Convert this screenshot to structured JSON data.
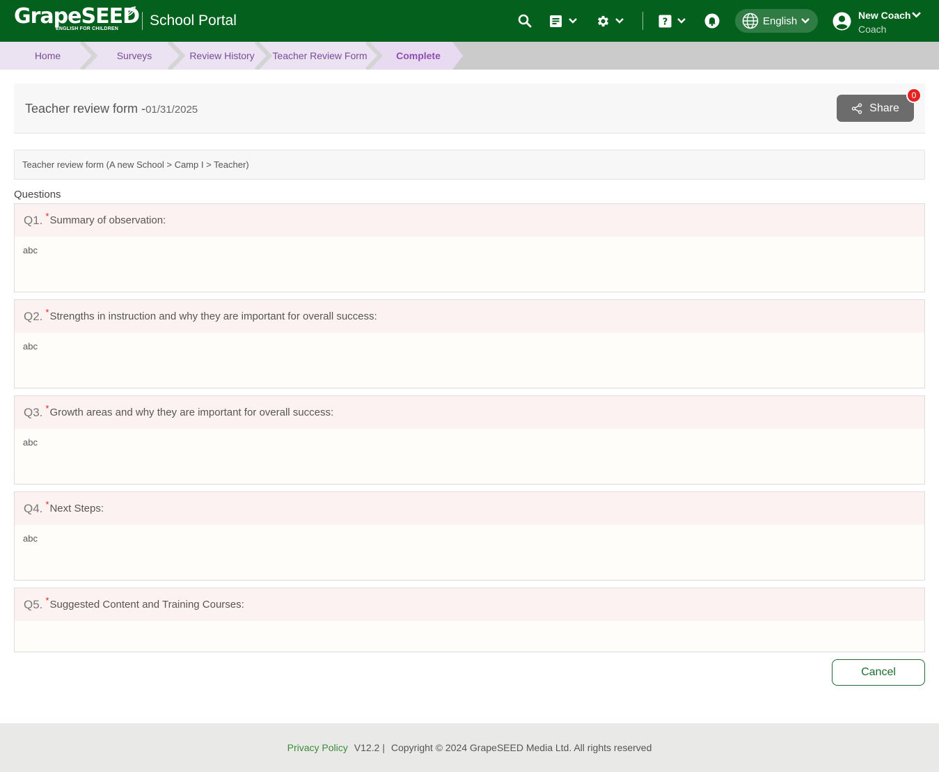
{
  "header": {
    "logo_text": "GrapeSEED",
    "logo_tagline": "ENGLISH FOR CHILDREN",
    "portal_title": "School Portal",
    "language": "English",
    "user_name": "New Coach",
    "user_role": "Coach",
    "colors": {
      "bar": "#03601d"
    },
    "icons": [
      "search-icon",
      "document-icon",
      "gear-icon",
      "help-icon",
      "bell-icon",
      "globe-icon",
      "user-avatar-icon"
    ]
  },
  "breadcrumbs": [
    {
      "label": "Home"
    },
    {
      "label": "Surveys"
    },
    {
      "label": "Review History"
    },
    {
      "label": "Teacher Review Form"
    },
    {
      "label": "Complete"
    }
  ],
  "page": {
    "title": "Teacher review form -",
    "date": "01/31/2025",
    "share_label": "Share",
    "share_count": "0",
    "context": "Teacher review form (A new School > Camp I > Teacher)",
    "questions_label": "Questions"
  },
  "questions": [
    {
      "num": "Q1.",
      "required": "*",
      "text": "Summary of observation:",
      "answer": "abc"
    },
    {
      "num": "Q2.",
      "required": "*",
      "text": "Strengths in instruction and why they are important for overall success:",
      "answer": "abc"
    },
    {
      "num": "Q3.",
      "required": "*",
      "text": "Growth areas and why they are important for overall success:",
      "answer": "abc"
    },
    {
      "num": "Q4.",
      "required": "*",
      "text": "Next Steps:",
      "answer": "abc"
    },
    {
      "num": "Q5.",
      "required": "*",
      "text": "Suggested Content and Training Courses:",
      "answer": ""
    }
  ],
  "actions": {
    "cancel_label": "Cancel"
  },
  "footer": {
    "privacy": "Privacy Policy",
    "version": "V12.2 |",
    "copyright": "Copyright © 2024 GrapeSEED Media Ltd. All rights reserved"
  }
}
